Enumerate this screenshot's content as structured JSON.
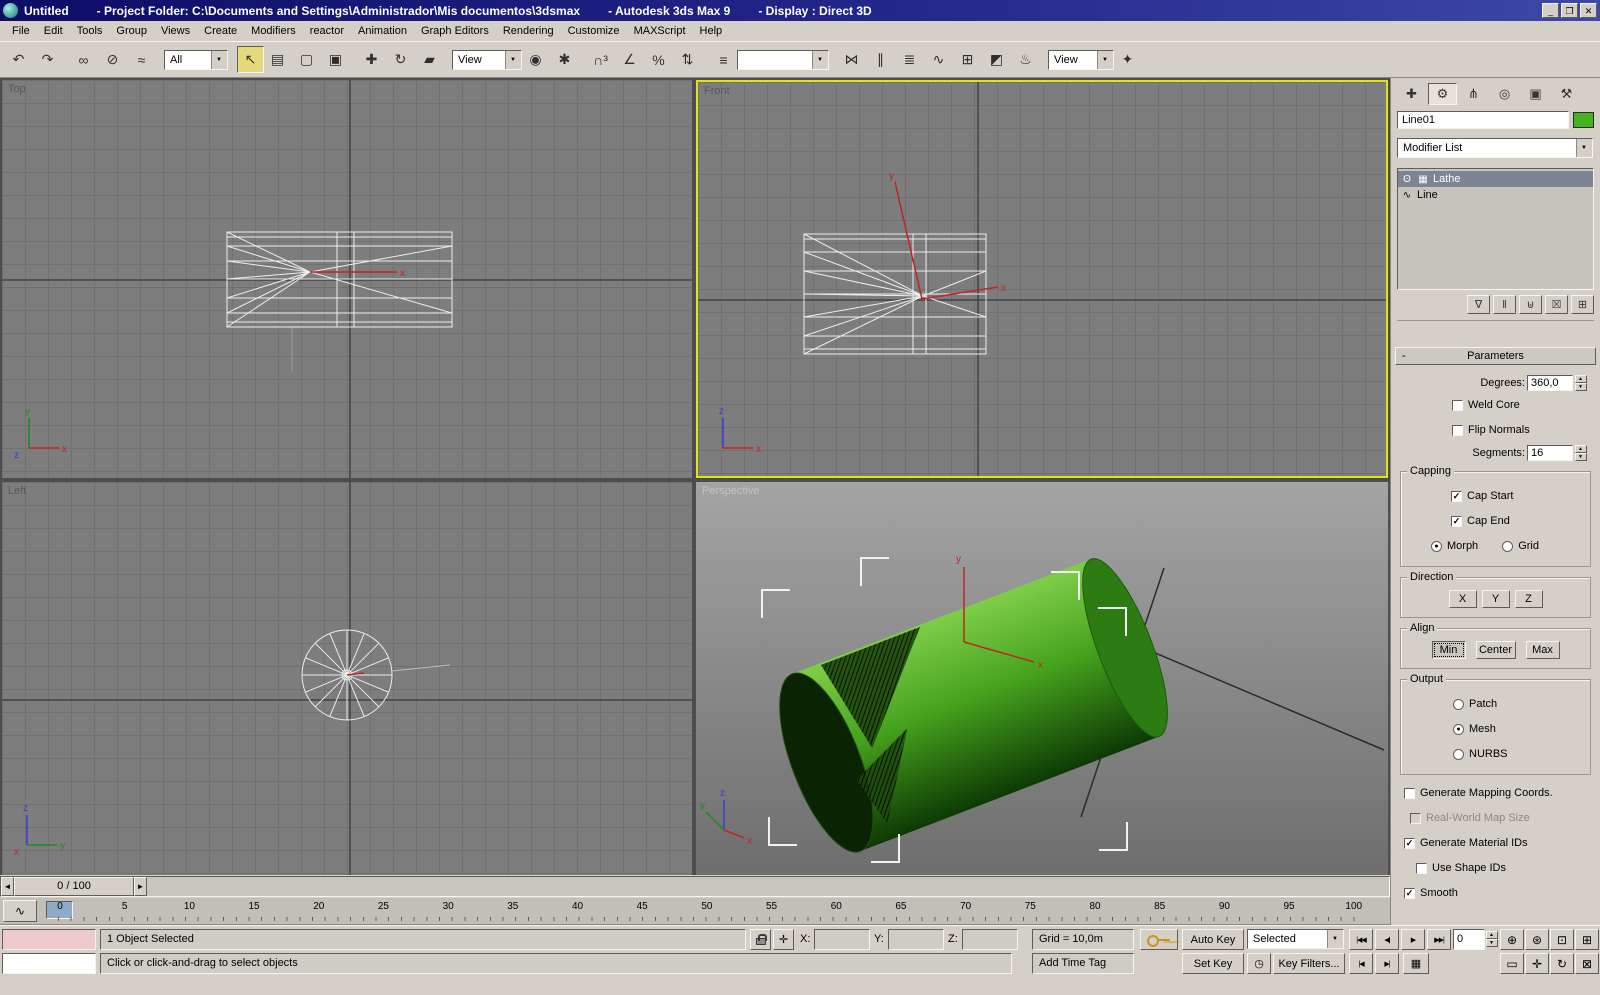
{
  "window": {
    "title_parts": [
      "Untitled",
      "- Project Folder: C:\\Documents and Settings\\Administrador\\Mis documentos\\3dsmax",
      "- Autodesk 3ds Max 9",
      "- Display : Direct 3D"
    ],
    "minimize_glyph": "_",
    "maximize_glyph": "❐",
    "close_glyph": "✕"
  },
  "menu": {
    "items": [
      "File",
      "Edit",
      "Tools",
      "Group",
      "Views",
      "Create",
      "Modifiers",
      "reactor",
      "Animation",
      "Graph Editors",
      "Rendering",
      "Customize",
      "MAXScript",
      "Help"
    ]
  },
  "toolbar": {
    "undo_group": [
      {
        "name": "undo-button",
        "glyph": "↶"
      },
      {
        "name": "redo-button",
        "glyph": "↷"
      }
    ],
    "link_group": [
      {
        "name": "select-and-link-button",
        "glyph": "∞"
      },
      {
        "name": "unlink-selection-button",
        "glyph": "⊘"
      },
      {
        "name": "bind-to-space-warp-button",
        "glyph": "≈"
      }
    ],
    "selection_filter_value": "All",
    "select_object_glyph": "↖",
    "select_group": [
      {
        "name": "select-by-name-button",
        "glyph": "▤"
      },
      {
        "name": "rectangular-selection-region-button",
        "glyph": "▢"
      },
      {
        "name": "window-crossing-toggle-button",
        "glyph": "▣"
      }
    ],
    "transform_group": [
      {
        "name": "select-and-move-button",
        "glyph": "✚"
      },
      {
        "name": "select-and-rotate-button",
        "glyph": "↻"
      },
      {
        "name": "select-and-scale-button",
        "glyph": "▰"
      }
    ],
    "ref_coord_value": "View",
    "center_group": [
      {
        "name": "use-pivot-point-center-button",
        "glyph": "◉"
      },
      {
        "name": "select-and-manipulate-button",
        "glyph": "✱"
      }
    ],
    "snap_group": [
      {
        "name": "snaps-toggle-button",
        "glyph": "∩³"
      },
      {
        "name": "angle-snap-button",
        "glyph": "∠"
      },
      {
        "name": "percent-snap-button",
        "glyph": "%"
      },
      {
        "name": "spinner-snap-button",
        "glyph": "⇅"
      }
    ],
    "edit_named_sets_glyph": "≡",
    "named_sets_value": "",
    "tools_group": [
      {
        "name": "mirror-button",
        "glyph": "⋈"
      },
      {
        "name": "align-button",
        "glyph": "∥"
      },
      {
        "name": "layer-manager-button",
        "glyph": "≣"
      },
      {
        "name": "curve-editor-button",
        "glyph": "∿"
      },
      {
        "name": "schematic-view-button",
        "glyph": "⊞"
      },
      {
        "name": "material-editor-button",
        "glyph": "◩"
      },
      {
        "name": "render-scene-button",
        "glyph": "♨"
      }
    ],
    "render_view_value": "View",
    "quick_render_glyph": "✦"
  },
  "viewports": {
    "top_label": "Top",
    "front_label": "Front",
    "left_label": "Left",
    "perspective_label": "Perspective"
  },
  "command_panel": {
    "tabs": [
      {
        "glyph": "✚"
      },
      {
        "glyph": "⚙"
      },
      {
        "glyph": "⋔"
      },
      {
        "glyph": "◎"
      },
      {
        "glyph": "▣"
      },
      {
        "glyph": "⚒"
      }
    ],
    "object_name": "Line01",
    "modifier_list_label": "Modifier List",
    "stack": {
      "bulb_glyph": "ʘ",
      "lathe_icon_glyph": "▦",
      "lathe": "Lathe",
      "line_icon_glyph": "∿",
      "line": "Line"
    },
    "stack_buttons": [
      {
        "name": "pin-stack-button",
        "glyph": "∇"
      },
      {
        "name": "show-end-result-button",
        "glyph": "‖"
      },
      {
        "name": "make-unique-button",
        "glyph": "⊎"
      },
      {
        "name": "remove-modifier-button",
        "glyph": "☒"
      },
      {
        "name": "configure-modifier-sets-button",
        "glyph": "⊞"
      }
    ],
    "parameters": {
      "title": "Parameters",
      "collapse_glyph": "-",
      "degrees_label": "Degrees:",
      "degrees_value": "360,0",
      "weld_core_label": "Weld Core",
      "weld_core_check": "",
      "flip_normals_label": "Flip Normals",
      "flip_normals_check": "",
      "segments_label": "Segments:",
      "segments_value": "16",
      "capping_title": "Capping",
      "cap_start_label": "Cap Start",
      "cap_start_check": "✓",
      "cap_end_label": "Cap End",
      "cap_end_check": "✓",
      "morph_label": "Morph",
      "morph_dot": "●",
      "grid_label": "Grid",
      "grid_dot": "",
      "direction_title": "Direction",
      "dir_x": "X",
      "dir_y": "Y",
      "dir_z": "Z",
      "align_title": "Align",
      "align_min": "Min",
      "align_center": "Center",
      "align_max": "Max",
      "output_title": "Output",
      "patch_label": "Patch",
      "patch_dot": "",
      "mesh_label": "Mesh",
      "mesh_dot": "●",
      "nurbs_label": "NURBS",
      "nurbs_dot": "",
      "gen_mapping_label": "Generate Mapping Coords.",
      "gen_mapping_check": "",
      "real_world_label": "Real-World Map Size",
      "real_world_check": "",
      "gen_material_label": "Generate Material IDs",
      "gen_material_check": "✓",
      "use_shape_label": "Use Shape IDs",
      "use_shape_check": "",
      "smooth_label": "Smooth",
      "smooth_check": "✓"
    }
  },
  "timeline": {
    "slider_value": "0 / 100",
    "prev_glyph": "◄",
    "next_glyph": "►",
    "curve_editor_glyph": "∿",
    "ticks": [
      "0",
      "5",
      "10",
      "15",
      "20",
      "25",
      "30",
      "35",
      "40",
      "45",
      "50",
      "55",
      "60",
      "65",
      "70",
      "75",
      "80",
      "85",
      "90",
      "95",
      "100"
    ]
  },
  "status": {
    "selection_text": "1 Object Selected",
    "prompt_text": "Click or click-and-drag to select objects",
    "x_label": "X:",
    "y_label": "Y:",
    "z_label": "Z:",
    "x_value": "",
    "y_value": "",
    "z_value": "",
    "grid_text": "Grid = 10,0m",
    "add_time_tag": "Add Time Tag",
    "abs_toggle_glyph": "✛",
    "auto_key_label": "Auto Key",
    "set_key_label": "Set Key",
    "key_mode_value": "Selected",
    "key_filters_label": "Key Filters...",
    "frame_value": "0",
    "playback": [
      {
        "name": "go-to-start-button",
        "glyph": "|◀◀"
      },
      {
        "name": "previous-frame-button",
        "glyph": "◀|"
      },
      {
        "name": "play-button",
        "glyph": "▶"
      },
      {
        "name": "go-to-end-button",
        "glyph": "▶▶|"
      }
    ],
    "key_nav": [
      {
        "name": "previous-key-button",
        "glyph": "|◀"
      },
      {
        "name": "next-key-button",
        "glyph": "▶|"
      }
    ],
    "nav_row1": [
      {
        "name": "zoom-button",
        "glyph": "⊕"
      },
      {
        "name": "zoom-all-button",
        "glyph": "⊛"
      },
      {
        "name": "zoom-extents-button",
        "glyph": "⊡"
      },
      {
        "name": "zoom-extents-all-button",
        "glyph": "⊞"
      }
    ],
    "nav_row2": [
      {
        "name": "zoom-region-button",
        "glyph": "▭"
      },
      {
        "name": "pan-view-button",
        "glyph": "✛"
      },
      {
        "name": "arc-rotate-button",
        "glyph": "↻"
      },
      {
        "name": "min-max-toggle-button",
        "glyph": "⊠"
      }
    ],
    "keyboard_override_glyph": "▦",
    "time_config_glyph": "◷"
  }
}
